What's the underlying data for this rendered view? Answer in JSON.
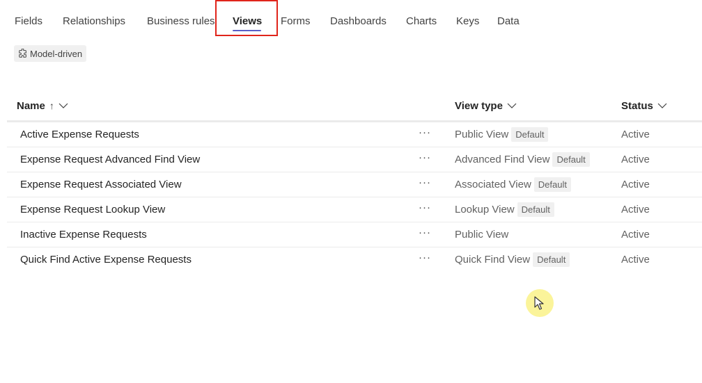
{
  "tabs": [
    {
      "label": "Fields"
    },
    {
      "label": "Relationships"
    },
    {
      "label": "Business rules"
    },
    {
      "label": "Views",
      "active": true
    },
    {
      "label": "Forms"
    },
    {
      "label": "Dashboards"
    },
    {
      "label": "Charts"
    },
    {
      "label": "Keys"
    },
    {
      "label": "Data"
    }
  ],
  "chip": {
    "label": "Model-driven",
    "icon": "puzzle-icon"
  },
  "table": {
    "columns": {
      "name": {
        "label": "Name",
        "sort_glyph": "↑",
        "menu_glyph": "chevron-down-icon"
      },
      "view_type": {
        "label": "View type",
        "menu_glyph": "chevron-down-icon"
      },
      "status": {
        "label": "Status",
        "menu_glyph": "chevron-down-icon"
      }
    },
    "more_label": "···",
    "rows": [
      {
        "name": "Active Expense Requests",
        "view_type": "Public View",
        "badge": "Default",
        "status": "Active"
      },
      {
        "name": "Expense Request Advanced Find View",
        "view_type": "Advanced Find View",
        "badge": "Default",
        "status": "Active"
      },
      {
        "name": "Expense Request Associated View",
        "view_type": "Associated View",
        "badge": "Default",
        "status": "Active"
      },
      {
        "name": "Expense Request Lookup View",
        "view_type": "Lookup View",
        "badge": "Default",
        "status": "Active"
      },
      {
        "name": "Inactive Expense Requests",
        "view_type": "Public View",
        "badge": "",
        "status": "Active"
      },
      {
        "name": "Quick Find Active Expense Requests",
        "view_type": "Quick Find View",
        "badge": "Default",
        "status": "Active"
      }
    ]
  },
  "colors": {
    "accent": "#5b5fc7",
    "highlight_box": "#e0241b",
    "cursor_halo": "#f7ee7a"
  }
}
